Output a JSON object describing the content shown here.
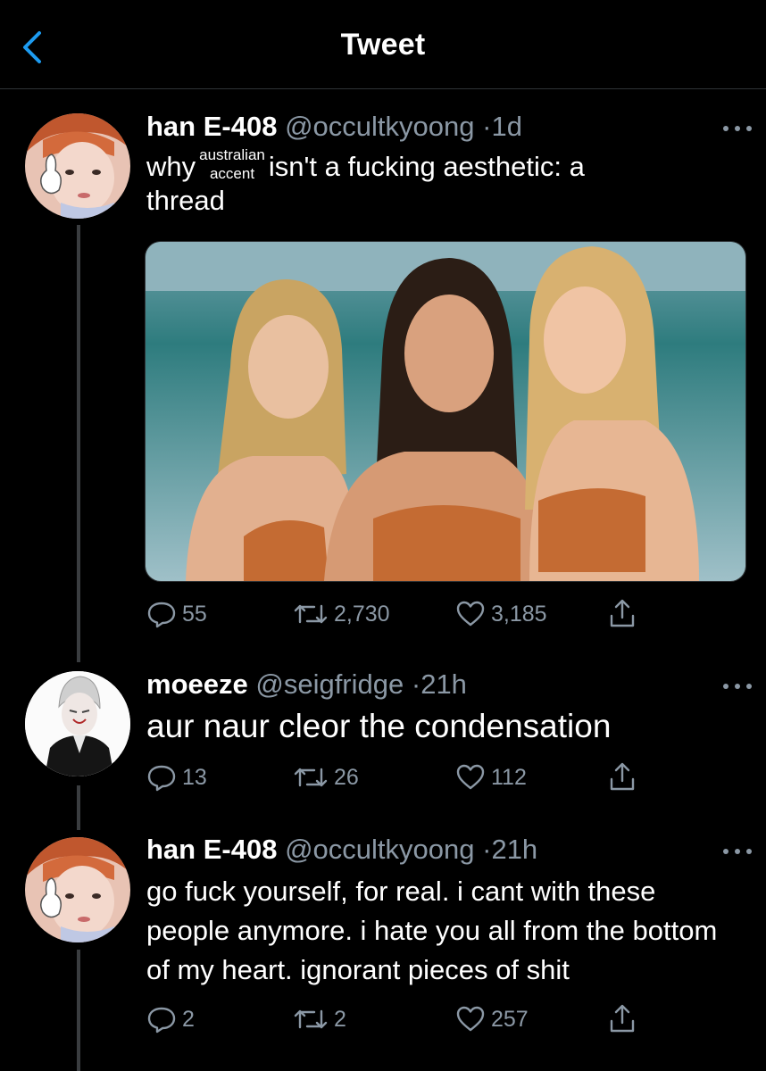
{
  "header": {
    "title": "Tweet",
    "back_icon": "chevron-left-icon",
    "accent": "#1d9bf0"
  },
  "tweets": [
    {
      "name": "han E-408",
      "handle": "@occultkyoong",
      "sep": "·",
      "time": "1d",
      "text_before": "why",
      "overlay_line1": "australian",
      "overlay_line2": "accent",
      "text_after": "isn't a fucking aesthetic: a",
      "text_line2": "thread",
      "media": "photo of three women in a pool",
      "stats": {
        "replies": "55",
        "retweets": "2,730",
        "likes": "3,185"
      }
    },
    {
      "name": "moeeze",
      "handle": "@seigfridge",
      "sep": "·",
      "time": "21h",
      "text": "aur naur cleor the condensation",
      "stats": {
        "replies": "13",
        "retweets": "26",
        "likes": "112"
      }
    },
    {
      "name": "han E-408",
      "handle": "@occultkyoong",
      "sep": "·",
      "time": "21h",
      "text": "go fuck yourself, for real. i cant with these people anymore. i hate you all from the bottom of my heart. ignorant pieces of shit",
      "stats": {
        "replies": "2",
        "retweets": "2",
        "likes": "257"
      }
    }
  ],
  "colors": {
    "background": "#000000",
    "secondary_text": "#8b98a5",
    "divider": "#2f3336"
  }
}
